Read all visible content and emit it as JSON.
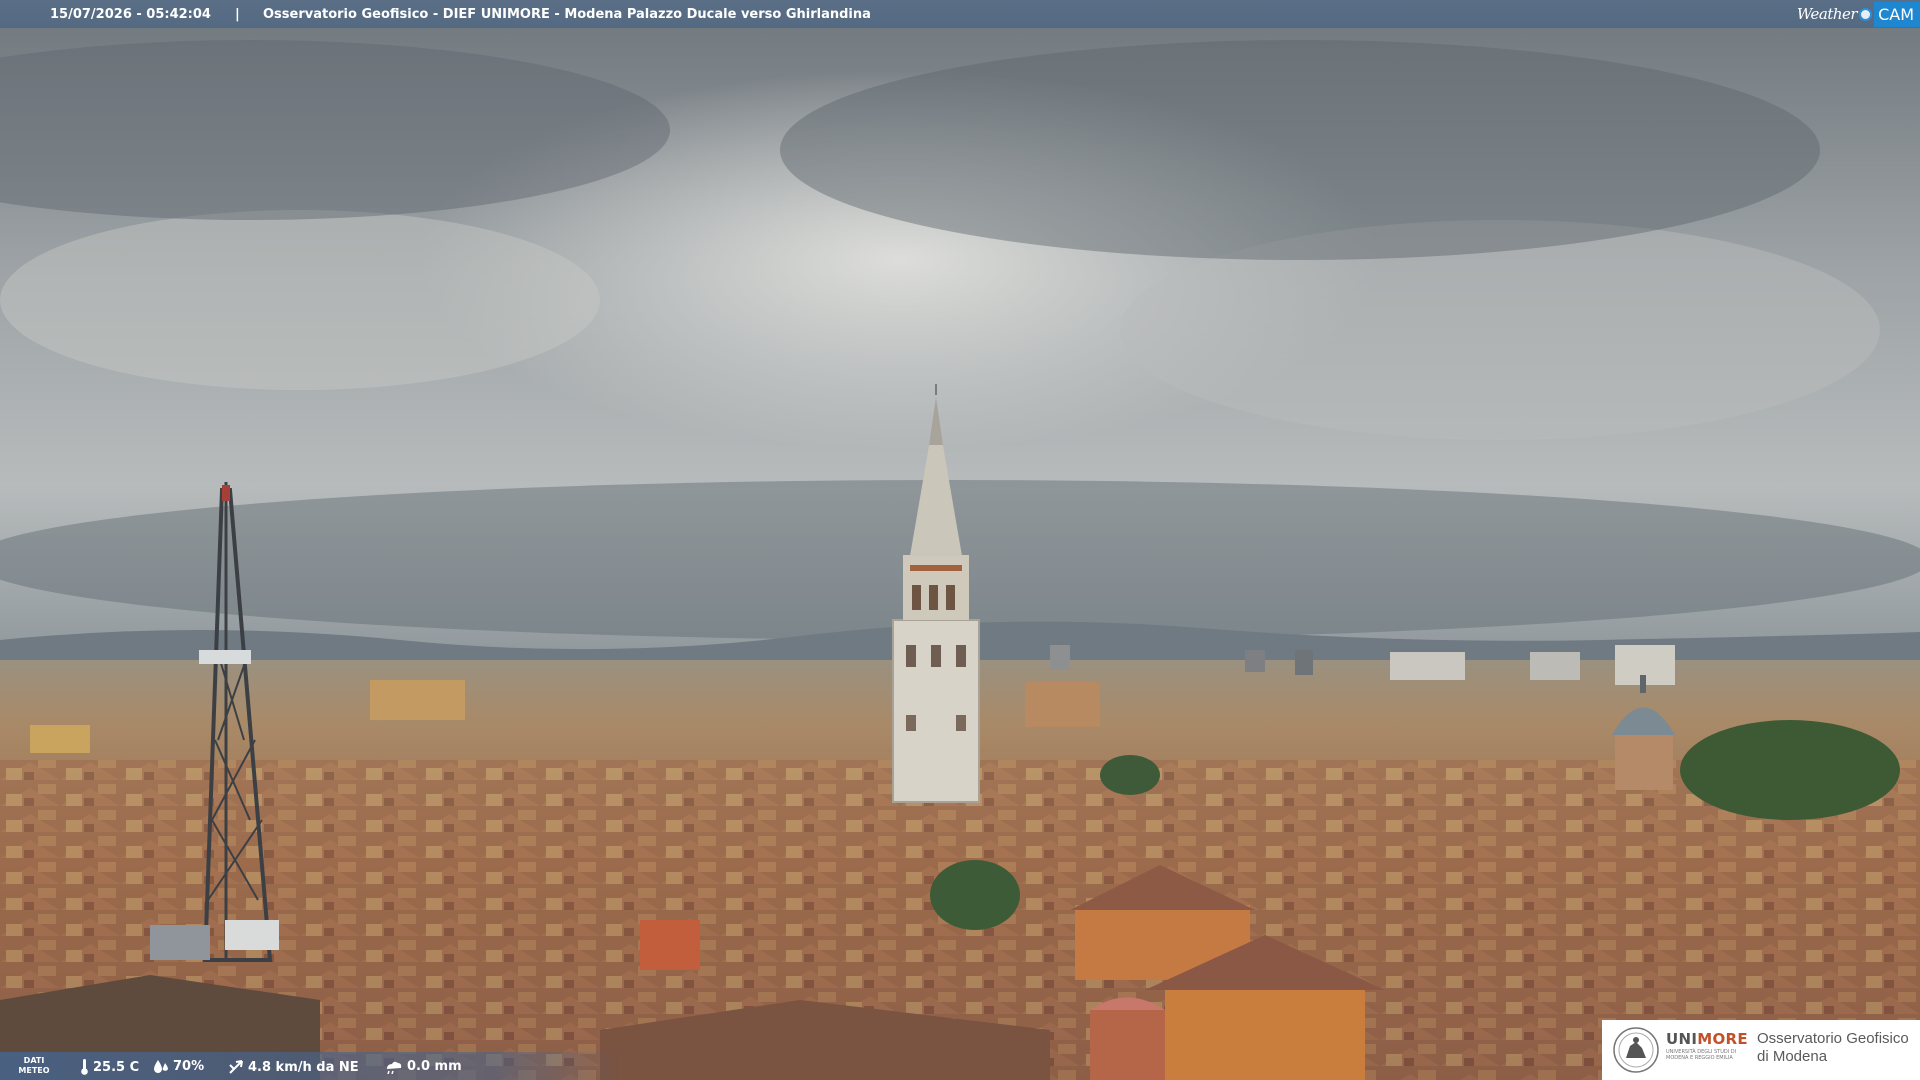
{
  "header": {
    "timestamp": "15/07/2026 - 05:42:04",
    "separator": "|",
    "caption": "Osservatorio Geofisico - DIEF UNIMORE - Modena Palazzo Ducale verso Ghirlandina",
    "brand_word": "Weather",
    "brand_cam": "CAM"
  },
  "meteo": {
    "label_line1": "DATI",
    "label_line2": "METEO",
    "temperature": "25.5 C",
    "humidity": "70%",
    "wind": "4.8 km/h da NE",
    "rain": "0.0 mm"
  },
  "logo": {
    "uni_part1": "UNI",
    "uni_part2": "MORE",
    "uni_subtitle": "UNIVERSITÀ DEGLI STUDI DI MODENA E REGGIO EMILIA",
    "observatory_line1": "Osservatorio Geofisico",
    "observatory_line2": "di Modena"
  },
  "colors": {
    "header_bar": "#566c84",
    "brand_cam_bg": "#1f86d0",
    "unimore_accent": "#c2512a"
  }
}
